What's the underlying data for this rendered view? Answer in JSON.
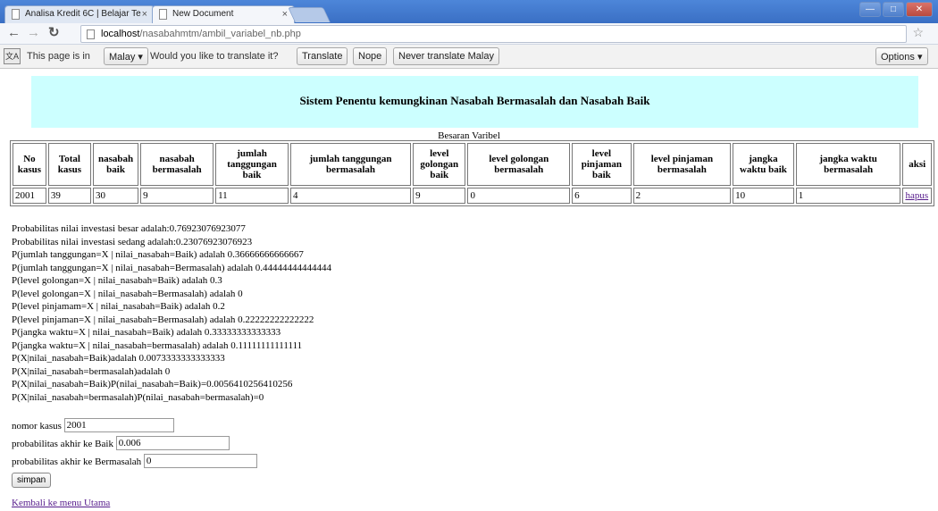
{
  "browser": {
    "tabs": [
      {
        "label": "Analisa Kredit 6C | Belajar Te"
      },
      {
        "label": "New Document"
      }
    ],
    "tab_close": "×",
    "url_host": "localhost",
    "url_path": "/nasabahmtm/ambil_variabel_nb.php"
  },
  "translate_bar": {
    "text_before": "This page is in",
    "language": "Malay",
    "text_after": "Would you like to translate it?",
    "translate_label": "Translate",
    "nope_label": "Nope",
    "never_label": "Never translate Malay",
    "options_label": "Options"
  },
  "page": {
    "title": "Sistem Penentu kemungkinan Nasabah Bermasalah dan Nasabah Baik",
    "table_caption": "Besaran Varibel",
    "table": {
      "headers": [
        "No kasus",
        "Total kasus",
        "nasabah baik",
        "nasabah bermasalah",
        "jumlah tanggungan baik",
        "jumlah tanggungan bermasalah",
        "level golongan baik",
        "level golongan bermasalah",
        "level pinjaman baik",
        "level pinjaman bermasalah",
        "jangka waktu baik",
        "jangka waktu bermasalah",
        "aksi"
      ],
      "rows": [
        [
          "2001",
          "39",
          "30",
          "9",
          "11",
          "4",
          "9",
          "0",
          "6",
          "2",
          "10",
          "1",
          "hapus"
        ]
      ]
    },
    "results": [
      "Probabilitas nilai investasi besar adalah:0.76923076923077",
      "Probabilitas nilai investasi sedang adalah:0.23076923076923",
      "P(jumlah tanggungan=X | nilai_nasabah=Baik) adalah 0.36666666666667",
      "P(jumlah tanggungan=X | nilai_nasabah=Bermasalah) adalah 0.44444444444444",
      "P(level golongan=X | nilai_nasabah=Baik) adalah 0.3",
      "P(level golongan=X | nilai_nasabah=Bermasalah) adalah 0",
      "P(level pinjamam=X | nilai_nasabah=Baik) adalah 0.2",
      "P(level pinjaman=X | nilai_nasabah=Bermasalah) adalah 0.22222222222222",
      "P(jangka waktu=X | nilai_nasabah=Baik) adalah 0.33333333333333",
      "P(jangka waktu=X | nilai_nasabah=bermasalah) adalah 0.11111111111111",
      "P(X|nilai_nasabah=Baik)adalah 0.0073333333333333",
      "P(X|nilai_nasabah=bermasalah)adalah 0",
      "P(X|nilai_nasabah=Baik)P(nilai_nasabah=Baik)=0.0056410256410256",
      "P(X|nilai_nasabah=bermasalah)P(nilai_nasabah=bermasalah)=0"
    ],
    "form": {
      "nomor_label": "nomor kasus",
      "nomor_value": "2001",
      "baik_label": "probabilitas akhir ke Baik",
      "baik_value": "0.006",
      "bermasalah_label": "probabilitas akhir ke Bermasalah",
      "bermasalah_value": "0",
      "save_label": "simpan"
    },
    "back_link": "Kembali ke menu Utama"
  }
}
